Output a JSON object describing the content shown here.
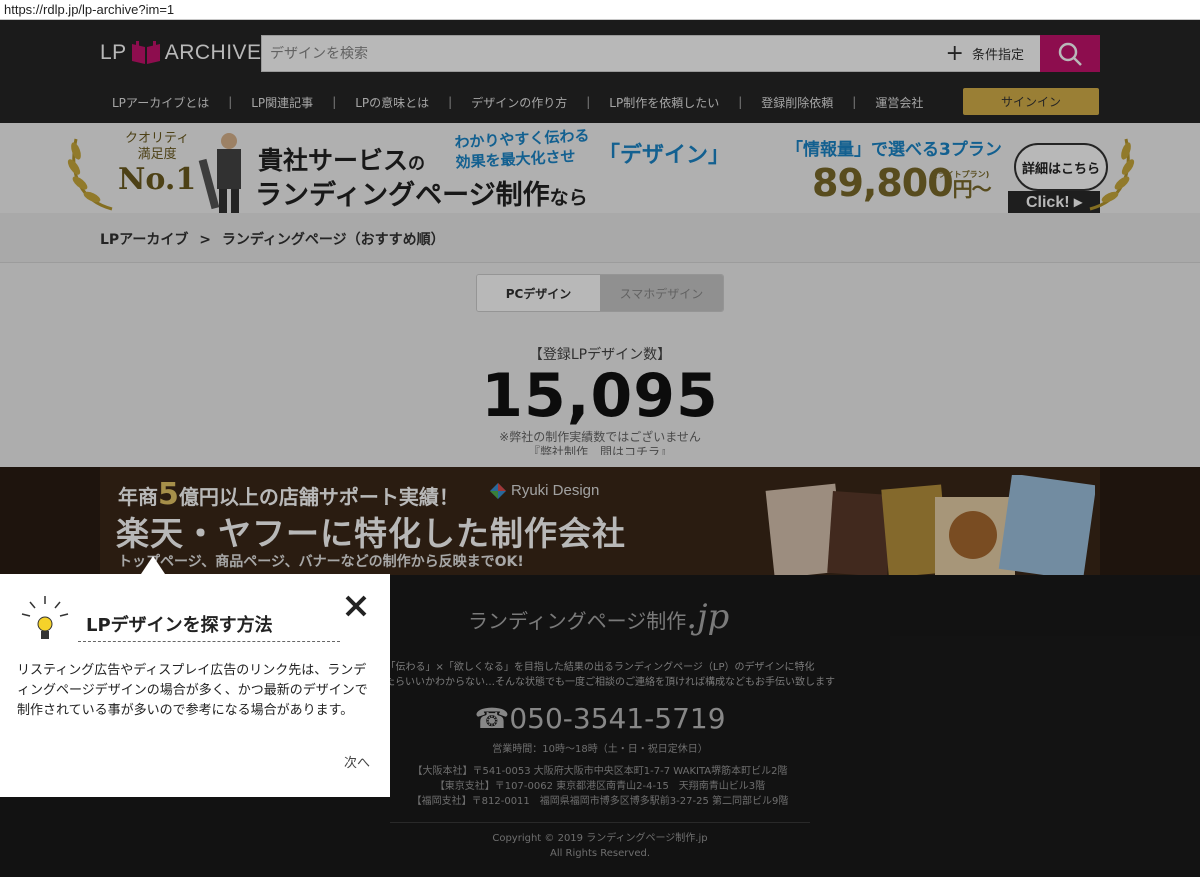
{
  "browser": {
    "url": "https://rdlp.jp/lp-archive?im=1"
  },
  "header": {
    "logo_left": "LP",
    "logo_right": "ARCHIVE",
    "search_placeholder": "デザインを検索",
    "condition_label": "条件指定",
    "signin_label": "サインイン",
    "nav": [
      "LPアーカイブとは",
      "LP関連記事",
      "LPの意味とは",
      "デザインの作り方",
      "LP制作を依頼したい",
      "登録削除依頼",
      "運営会社"
    ],
    "nav_separator": "|"
  },
  "top_banner": {
    "quality": "クオリティ",
    "satisfaction": "満足度",
    "no1": "No.1",
    "line1_a": "貴社サービス",
    "line1_b": "の",
    "line2_a": "ランディングページ制作",
    "line2_b": "なら",
    "blue1": "わかりやすく伝わる",
    "blue2": "効果を最大化させ",
    "design": "「デザイン」",
    "plan": "「情報量」で選べる3プラン",
    "price": "89,800",
    "price_unit": "円～",
    "lite_plan": "(ライトプラン)",
    "details": "詳細はこちら",
    "click": "Click! ▸"
  },
  "breadcrumb": {
    "root": "LPアーカイブ",
    "separator": ">",
    "current": "ランディングページ（おすすめ順）"
  },
  "tabs": [
    {
      "label": "PCデザイン",
      "active": true
    },
    {
      "label": "スマホデザイン",
      "active": false
    }
  ],
  "counter": {
    "label": "【登録LPデザイン数】",
    "value": "15,095",
    "note": "※弊社の制作実績数ではございません",
    "note2": "『弊社制作　問はコチラ』"
  },
  "ad_banner": {
    "line1_a": "年商",
    "line1_big": "5",
    "line1_b": "億円以上の店舗サポート実績！",
    "brand": "Ryuki Design",
    "line2": "楽天・ヤフーに特化した制作会社",
    "line3": "トップページ、商品ページ、バナーなどの制作から反映までOK!"
  },
  "footer": {
    "logo": "ランディングページ制作",
    "logo_jp": ".jp",
    "desc1": "「伝わる」×「欲しくなる」を目指した結果の出るランディングページ（LP）のデザインに特化",
    "desc2": "作ったらいいかわからない…そんな状態でも一度ご相談のご連絡を頂ければ構成などもお手伝い致します",
    "phone": "☎050-3541-5719",
    "hours": "営業時間：10時～18時（土・日・祝日定休日）",
    "address1": "【大阪本社】〒541-0053 大阪府大阪市中央区本町1-7-7 WAKITA堺筋本町ビル2階",
    "address2": "【東京支社】〒107-0062 東京都港区南青山2-4-15　天翔南青山ビル3階",
    "address3": "【福岡支社】〒812-0011　福岡県福岡市博多区博多駅前3-27-25 第二同部ビル9階",
    "copyright": "Copyright © 2019 ランディングページ制作.jp",
    "rights": "All Rights Reserved."
  },
  "popup": {
    "title": "LPデザインを探す方法",
    "body": "リスティング広告やディスプレイ広告のリンク先は、ランディングページデザインの場合が多く、かつ最新のデザインで制作されている事が多いので参考になる場合があります。",
    "next_label": "次へ"
  },
  "colors": {
    "accent": "#c4136c",
    "signin": "#d6b04a",
    "header_bg": "#262626",
    "banner_blue": "#1b86c8"
  }
}
